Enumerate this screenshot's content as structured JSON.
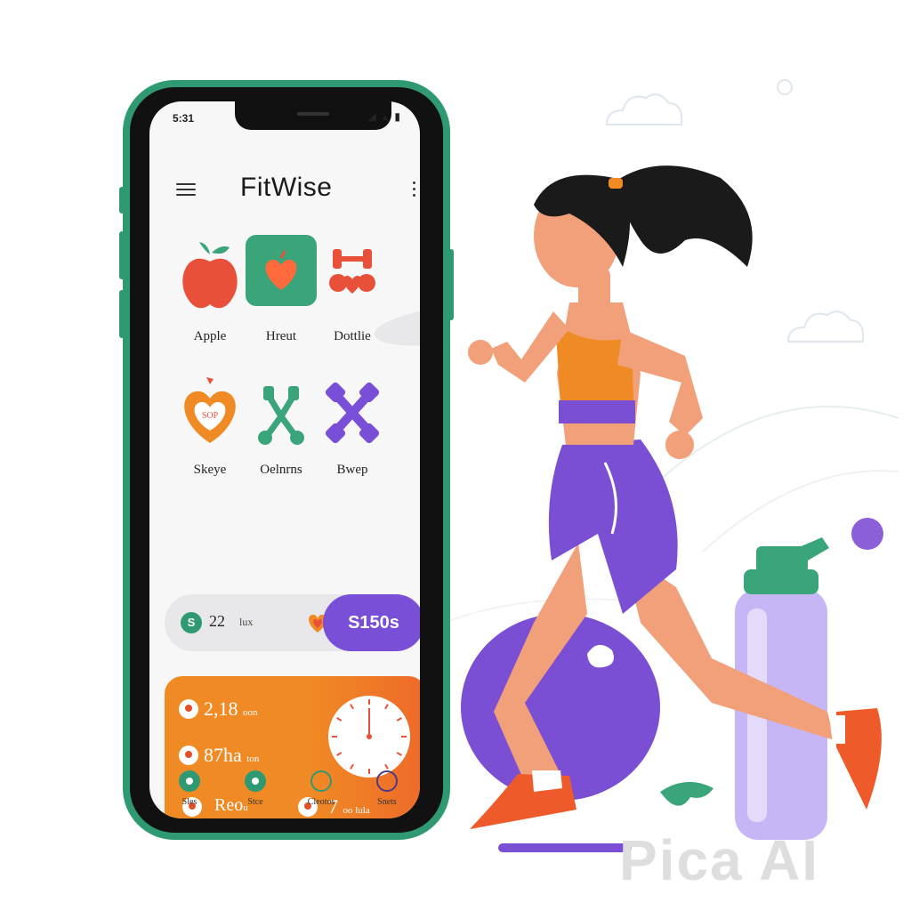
{
  "status_bar": {
    "time": "5:31",
    "icons": "◢ ▴ ▮"
  },
  "app": {
    "title": "FitWise"
  },
  "tiles": [
    {
      "label": "Apple",
      "icon": "apple-icon"
    },
    {
      "label": "Hreut",
      "icon": "heart-icon"
    },
    {
      "label": "Dottlie",
      "icon": "dumbbell-icon"
    },
    {
      "label": "Skeye",
      "icon": "heart-scale-icon"
    },
    {
      "label": "Oelnrns",
      "icon": "dumbbell-cross-icon"
    },
    {
      "label": "Bwep",
      "icon": "dumbbell-cross-purple-icon"
    }
  ],
  "summary": {
    "coin": "S",
    "value": "22",
    "unit": "lux",
    "price": "S150s"
  },
  "stats": {
    "row1": {
      "value": "2,18",
      "unit": "oon"
    },
    "row2": {
      "value": "87ha",
      "unit": "ton"
    },
    "row3a": {
      "value": "Reo",
      "unit": "u"
    },
    "row3b": {
      "value": "7",
      "unit": "oo lula"
    }
  },
  "tabbar": [
    {
      "label": "Sles"
    },
    {
      "label": "Stce"
    },
    {
      "label": "Cleotos"
    },
    {
      "label": "Snets"
    }
  ],
  "watermark": "Pica AI",
  "colors": {
    "green": "#2f9a72",
    "orange": "#f08a24",
    "purple": "#7a4fd8",
    "red": "#e2502b"
  }
}
